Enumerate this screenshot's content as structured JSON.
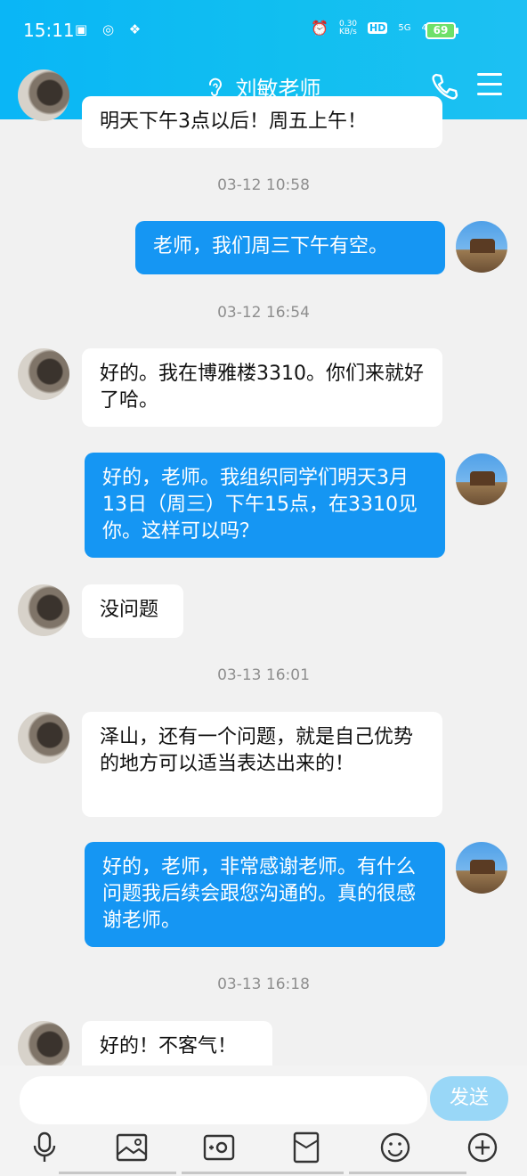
{
  "status_bar": {
    "time": "15:11",
    "left_icons": "▣ ◎ ❖",
    "net_speed_top": "0.30",
    "net_speed_bottom": "KB/s",
    "hd": "HD",
    "sig5g": "5G",
    "sig4g": "4G+",
    "battery": "69"
  },
  "header": {
    "title": "刘敏老师"
  },
  "messages": {
    "m0": "明天下午3点以后！周五上午！",
    "t1": "03-12 10:58",
    "m1": "老师，我们周三下午有空。",
    "t2": "03-12 16:54",
    "m2": "好的。我在博雅楼3310。你们来就好了哈。",
    "m3": "好的，老师。我组织同学们明天3月13日（周三）下午15点，在3310见你。这样可以吗？",
    "m4": "没问题",
    "t3": "03-13 16:01",
    "m5": "泽山，还有一个问题，就是自己优势的地方可以适当表达出来的！",
    "m6": "好的，老师，非常感谢老师。有什么问题我后续会跟您沟通的。真的很感谢老师。",
    "t4": "03-13 16:18",
    "m7": "好的！不客气！"
  },
  "input": {
    "placeholder": "",
    "send_label": "发送"
  },
  "toolbar_icons": [
    "microphone-icon",
    "image-icon",
    "camera-icon",
    "red-packet-icon",
    "emoji-icon",
    "plus-icon"
  ]
}
